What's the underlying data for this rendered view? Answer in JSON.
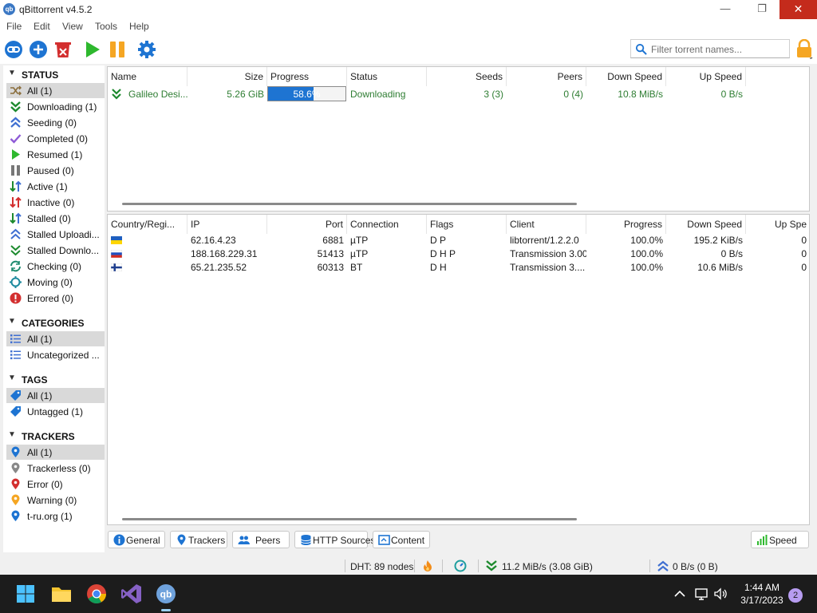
{
  "window": {
    "title": "qBittorrent v4.5.2",
    "app_icon_text": "qb",
    "min": "—",
    "max": "❐",
    "close": "✕"
  },
  "menu": [
    "File",
    "Edit",
    "View",
    "Tools",
    "Help"
  ],
  "toolbar": {
    "search_placeholder": "Filter torrent names...",
    "buttons": [
      "add-link",
      "add-torrent",
      "delete",
      "resume",
      "pause",
      "options"
    ]
  },
  "sidebar": {
    "status_header": "STATUS",
    "status_items": [
      {
        "label": "All (1)",
        "icon": "all-icon",
        "selected": true
      },
      {
        "label": "Downloading (1)",
        "icon": "downloading-icon"
      },
      {
        "label": "Seeding (0)",
        "icon": "seeding-icon"
      },
      {
        "label": "Completed (0)",
        "icon": "completed-icon"
      },
      {
        "label": "Resumed (1)",
        "icon": "resumed-icon"
      },
      {
        "label": "Paused (0)",
        "icon": "paused-icon"
      },
      {
        "label": "Active (1)",
        "icon": "active-icon"
      },
      {
        "label": "Inactive (0)",
        "icon": "inactive-icon"
      },
      {
        "label": "Stalled (0)",
        "icon": "stalled-icon"
      },
      {
        "label": "Stalled Uploadi...",
        "icon": "stalled-uploading-icon"
      },
      {
        "label": "Stalled Downlo...",
        "icon": "stalled-downloading-icon"
      },
      {
        "label": "Checking (0)",
        "icon": "checking-icon"
      },
      {
        "label": "Moving (0)",
        "icon": "moving-icon"
      },
      {
        "label": "Errored (0)",
        "icon": "errored-icon"
      }
    ],
    "categories_header": "CATEGORIES",
    "category_items": [
      {
        "label": "All (1)",
        "selected": true
      },
      {
        "label": "Uncategorized ..."
      }
    ],
    "tags_header": "TAGS",
    "tag_items": [
      {
        "label": "All (1)",
        "selected": true
      },
      {
        "label": "Untagged (1)"
      }
    ],
    "trackers_header": "TRACKERS",
    "tracker_items": [
      {
        "label": "All (1)",
        "selected": true
      },
      {
        "label": "Trackerless (0)"
      },
      {
        "label": "Error (0)"
      },
      {
        "label": "Warning (0)"
      },
      {
        "label": "t-ru.org (1)"
      }
    ]
  },
  "torrents": {
    "columns": [
      "Name",
      "Size",
      "Progress",
      "Status",
      "Seeds",
      "Peers",
      "Down Speed",
      "Up Speed"
    ],
    "rows": [
      {
        "name": "Galileo Desi...",
        "size": "5.26 GiB",
        "progress": 0.586,
        "progress_text": "58.6%",
        "status": "Downloading",
        "seeds": "3 (3)",
        "peers": "0 (4)",
        "down_speed": "10.8 MiB/s",
        "up_speed": "0 B/s"
      }
    ]
  },
  "peers": {
    "columns": [
      "Country/Regi...",
      "IP",
      "Port",
      "Connection",
      "Flags",
      "Client",
      "Progress",
      "Down Speed",
      "Up Spe"
    ],
    "rows": [
      {
        "flag": "ukraine",
        "ip": "62.16.4.23",
        "port": "6881",
        "connection": "µTP",
        "flags": "D P",
        "client": "libtorrent/1.2.2.0",
        "progress": "100.0%",
        "down_speed": "195.2 KiB/s",
        "up_speed": "0"
      },
      {
        "flag": "russia",
        "ip": "188.168.229.31",
        "port": "51413",
        "connection": "µTP",
        "flags": "D H P",
        "client": "Transmission 3.00",
        "progress": "100.0%",
        "down_speed": "0 B/s",
        "up_speed": "0"
      },
      {
        "flag": "finland",
        "ip": "65.21.235.52",
        "port": "60313",
        "connection": "BT",
        "flags": "D H",
        "client": "Transmission 3....",
        "progress": "100.0%",
        "down_speed": "10.6 MiB/s",
        "up_speed": "0"
      }
    ]
  },
  "tabs": [
    "General",
    "Trackers",
    "Peers",
    "HTTP Sources",
    "Content"
  ],
  "speed_tab": "Speed",
  "statusbar": {
    "dht": "DHT: 89 nodes",
    "download": "11.2 MiB/s (3.08 GiB)",
    "upload": "0 B/s (0 B)"
  },
  "taskbar": {
    "time": "1:44 AM",
    "date": "3/17/2023",
    "notifications": "2",
    "apps": [
      "start",
      "file-explorer",
      "chrome",
      "visual-studio",
      "qbittorrent"
    ]
  },
  "colors": {
    "accent": "#1e74d2",
    "close": "#c42b1c",
    "download_green": "#2e7d32"
  }
}
